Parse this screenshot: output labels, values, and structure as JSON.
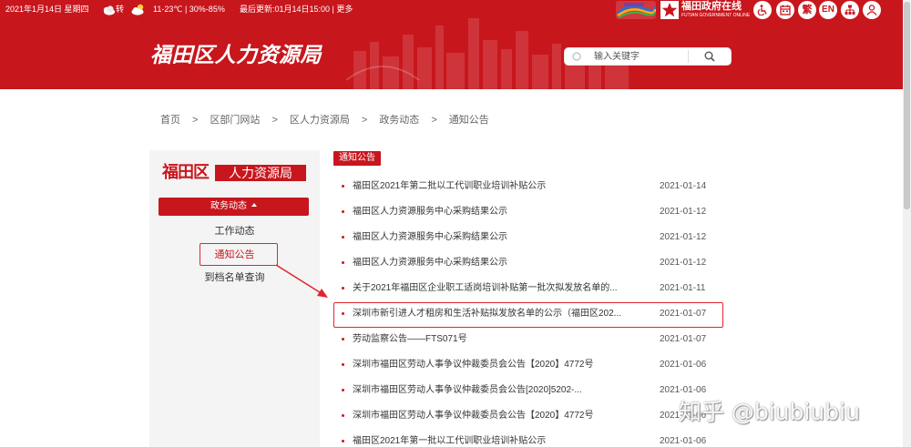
{
  "colors": {
    "primary": "#c8161d",
    "panel": "#f4f4f4",
    "annotation": "#e0262c"
  },
  "topbar": {
    "date": "2021年1月14日 星期四",
    "weather_change": "转",
    "weather": "11-23℃ | 30%-85%",
    "updated": "最后更新:01月14日15:00 | ",
    "more": "更多",
    "icons": [
      "cloudy-icon",
      "partly-sunny-icon"
    ]
  },
  "brand": {
    "name": "福田政府在线",
    "name_en": "FUTIAN GOVERNMENT ONLINE"
  },
  "tools": {
    "traditional": "繁",
    "english": "EN",
    "icons": [
      "accessibility-icon",
      "calendar-icon",
      "sitemap-icon",
      "user-icon"
    ]
  },
  "header": {
    "title": "福田区人力资源局"
  },
  "search": {
    "placeholder": "输入关键字"
  },
  "breadcrumb": {
    "separator": ">",
    "items": [
      "首页",
      "区部门网站",
      "区人力资源局",
      "政务动态",
      "通知公告"
    ]
  },
  "sidebar": {
    "logo_left": "福田区",
    "logo_right": "人力资源局",
    "section": "政务动态",
    "items": [
      "工作动态",
      "通知公告",
      "到档名单查询"
    ]
  },
  "list": {
    "tag": "通知公告",
    "items": [
      {
        "title": "福田区2021年第二批以工代训职业培训补贴公示",
        "date": "2021-01-14"
      },
      {
        "title": "福田区人力资源服务中心采购结果公示",
        "date": "2021-01-12"
      },
      {
        "title": "福田区人力资源服务中心采购结果公示",
        "date": "2021-01-12"
      },
      {
        "title": "福田区人力资源服务中心采购结果公示",
        "date": "2021-01-12"
      },
      {
        "title": "关于2021年福田区企业职工适岗培训补贴第一批次拟发放名单的...",
        "date": "2021-01-11"
      },
      {
        "title": "深圳市新引进人才租房和生活补贴拟发放名单的公示（福田区202...",
        "date": "2021-01-07"
      },
      {
        "title": "劳动监察公告——FTS071号",
        "date": "2021-01-07"
      },
      {
        "title": "深圳市福田区劳动人事争议仲裁委员会公告【2020】4772号",
        "date": "2021-01-06"
      },
      {
        "title": "深圳市福田区劳动人事争议仲裁委员会公告[2020]5202-...",
        "date": "2021-01-06"
      },
      {
        "title": "深圳市福田区劳动人事争议仲裁委员会公告【2020】4772号",
        "date": "2021-01-06"
      },
      {
        "title": "福田区2021年第一批以工代训职业培训补贴公示",
        "date": "2021-01-06"
      }
    ]
  },
  "watermark": "知乎 @biubiubiu"
}
